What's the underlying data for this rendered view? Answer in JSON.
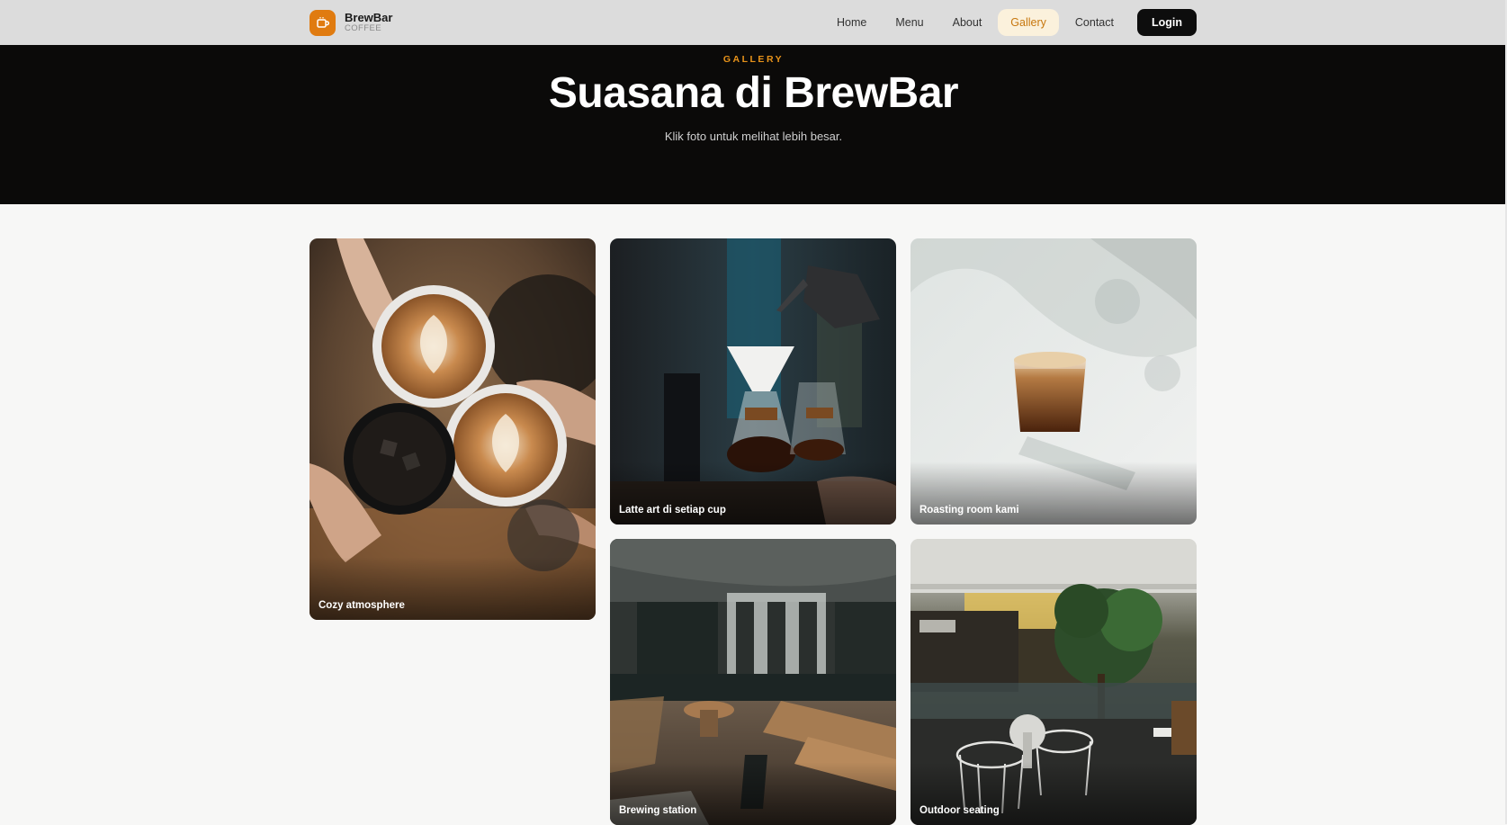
{
  "brand": {
    "name": "BrewBar",
    "sub": "COFFEE",
    "icon": "coffee-cup-icon",
    "accent": "#e07b10"
  },
  "nav": {
    "items": [
      {
        "label": "Home"
      },
      {
        "label": "Menu"
      },
      {
        "label": "About"
      },
      {
        "label": "Gallery",
        "active": true
      },
      {
        "label": "Contact"
      }
    ],
    "login_label": "Login"
  },
  "hero": {
    "eyebrow": "GALLERY",
    "title": "Suasana di BrewBar",
    "subtitle": "Klik foto untuk melihat lebih besar."
  },
  "gallery": {
    "items": [
      {
        "caption": "Cozy atmosphere"
      },
      {
        "caption": "Latte art di setiap cup"
      },
      {
        "caption": "Roasting room kami"
      },
      {
        "caption": "Brewing station"
      },
      {
        "caption": "Outdoor seating"
      }
    ]
  }
}
